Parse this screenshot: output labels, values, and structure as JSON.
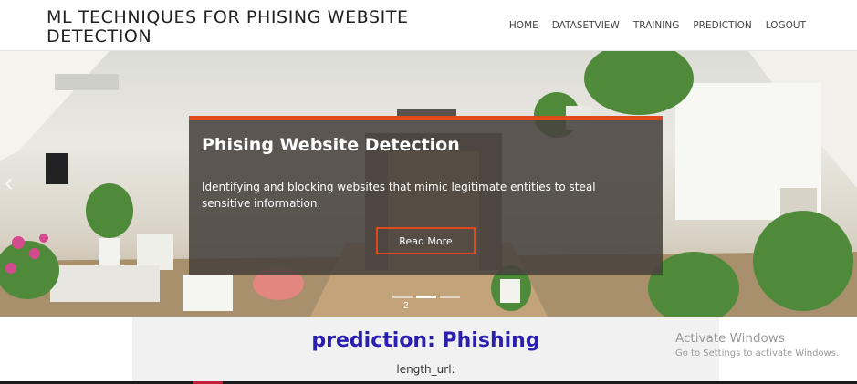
{
  "header": {
    "site_title": "ML TECHNIQUES FOR PHISING WEBSITE DETECTION",
    "nav": [
      "HOME",
      "DATASETVIEW",
      "TRAINING",
      "PREDICTION",
      "LOGOUT"
    ]
  },
  "hero": {
    "title": "Phising Website Detection",
    "description": "Identifying and blocking websites that mimic legitimate entities to steal sensitive information.",
    "button_label": "Read More",
    "prev_arrow": "‹",
    "slide_indicator_text": "2",
    "active_slide": 2,
    "slide_count": 3
  },
  "result": {
    "prediction_text": "prediction: Phishing",
    "field_label": "length_url:"
  },
  "watermark": {
    "title": "Activate Windows",
    "subtitle": "Go to Settings to activate Windows."
  },
  "colors": {
    "accent": "#e0481d",
    "prediction": "#2a1fb0"
  }
}
